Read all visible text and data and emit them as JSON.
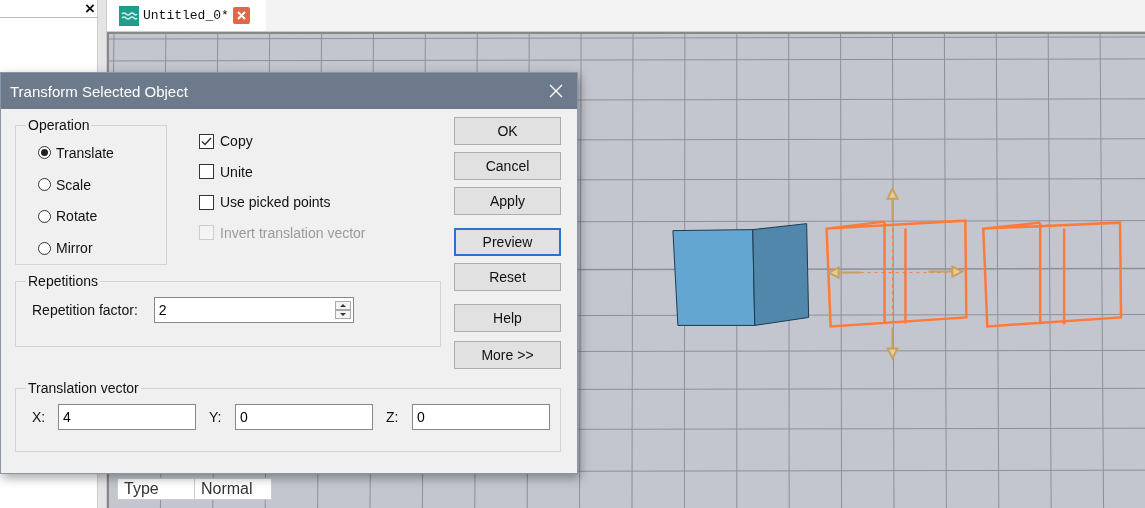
{
  "left_panel": {
    "close": "×"
  },
  "tabs": [
    {
      "label": "Untitled_0*",
      "selected": true
    }
  ],
  "properties": [
    {
      "name": "Type",
      "value": "Normal"
    }
  ],
  "dialog": {
    "title": "Transform Selected Object",
    "operation": {
      "title": "Operation",
      "options": [
        {
          "label": "Translate",
          "selected": true
        },
        {
          "label": "Scale",
          "selected": false
        },
        {
          "label": "Rotate",
          "selected": false
        },
        {
          "label": "Mirror",
          "selected": false
        }
      ]
    },
    "checkboxes": [
      {
        "label": "Copy",
        "checked": true,
        "disabled": false
      },
      {
        "label": "Unite",
        "checked": false,
        "disabled": false
      },
      {
        "label": "Use picked points",
        "checked": false,
        "disabled": false
      },
      {
        "label": "Invert translation vector",
        "checked": false,
        "disabled": true
      }
    ],
    "repetitions": {
      "title": "Repetitions",
      "label": "Repetition factor:",
      "value": "2"
    },
    "translation": {
      "title": "Translation vector",
      "fields": [
        {
          "label": "X:",
          "value": "4"
        },
        {
          "label": "Y:",
          "value": "0"
        },
        {
          "label": "Z:",
          "value": "0"
        }
      ]
    },
    "buttons": [
      {
        "label": "OK",
        "focused": false
      },
      {
        "label": "Cancel",
        "focused": false
      },
      {
        "label": "Apply",
        "focused": false
      },
      {
        "label": "Preview",
        "focused": true
      },
      {
        "label": "Reset",
        "focused": false
      },
      {
        "label": "Help",
        "focused": false
      },
      {
        "label": "More >>",
        "focused": false
      }
    ]
  }
}
